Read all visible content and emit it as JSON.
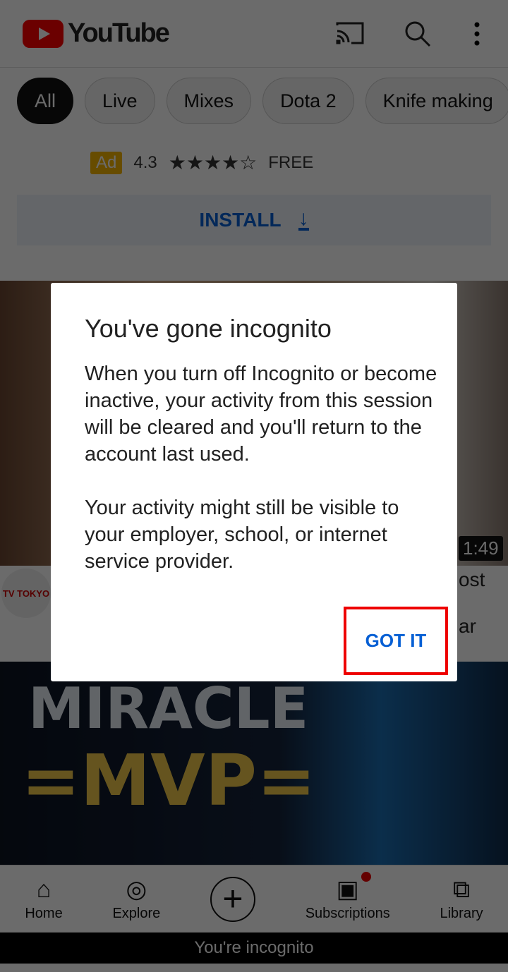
{
  "header": {
    "logo_text": "YouTube",
    "icons": [
      "cast-icon",
      "search-icon",
      "more-vert-icon"
    ]
  },
  "chips": [
    "All",
    "Live",
    "Mixes",
    "Dota 2",
    "Knife making"
  ],
  "ad": {
    "badge": "Ad",
    "rating": "4.3",
    "stars": "★★★★☆",
    "rating_value": 4.3,
    "price": "FREE",
    "install_label": "INSTALL"
  },
  "video1": {
    "duration": "1:49",
    "channel_logo": "TV TOKYO",
    "title_fragment_1": "ost",
    "title_fragment_2": "ar"
  },
  "video2": {
    "thumb_text_1": "MIRACLE",
    "thumb_text_2": "=MVP="
  },
  "nav": [
    {
      "label": "Home",
      "icon": "home-icon"
    },
    {
      "label": "Explore",
      "icon": "compass-icon"
    },
    {
      "label": "",
      "icon": "add-icon"
    },
    {
      "label": "Subscriptions",
      "icon": "subscriptions-icon"
    },
    {
      "label": "Library",
      "icon": "library-icon"
    }
  ],
  "incognito_bar": "You're incognito",
  "dialog": {
    "title": "You've gone incognito",
    "para1": "When you turn off Incognito or become inactive, your activity from this session will be cleared and you'll return to the account last used.",
    "para2": "Your activity might still be visible to your employer, school, or internet service provider.",
    "button": "GOT IT"
  },
  "colors": {
    "accent": "#065fd4",
    "highlight": "#ee0000",
    "brand": "#ff0000"
  }
}
